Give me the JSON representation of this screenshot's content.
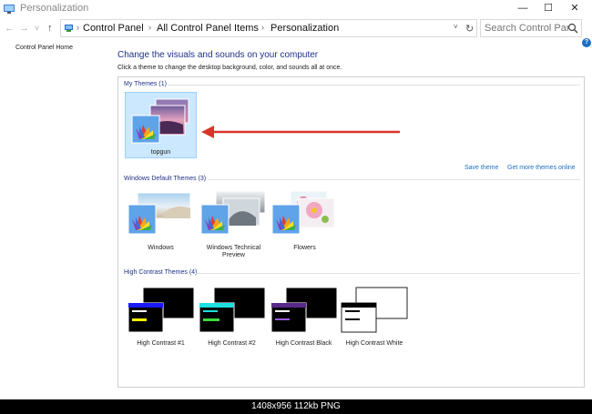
{
  "window": {
    "title": "Personalization",
    "controls": {
      "minimize": "—",
      "maximize": "☐",
      "close": "✕"
    }
  },
  "nav": {
    "back": "←",
    "forward": "→",
    "recent": "˅",
    "up": "↑",
    "breadcrumb": [
      "Control Panel",
      "All Control Panel Items",
      "Personalization"
    ],
    "breadcrumb_separator": "›",
    "dropdown": "˅",
    "refresh": "↻"
  },
  "search": {
    "placeholder": "Search Control Pan..."
  },
  "left_pane": {
    "home_link": "Control Panel Home"
  },
  "help": "?",
  "main": {
    "title": "Change the visuals and sounds on your computer",
    "subtitle": "Click a theme to change the desktop background, color, and sounds all at once.",
    "groups": {
      "my_themes": {
        "header": "My Themes (1)",
        "themes": [
          {
            "label": "topgun",
            "selected": true
          }
        ],
        "links": {
          "save": "Save theme",
          "more": "Get more themes online"
        }
      },
      "default_themes": {
        "header": "Windows Default Themes (3)",
        "themes": [
          {
            "label": "Windows"
          },
          {
            "label": "Windows Technical Preview"
          },
          {
            "label": "Flowers"
          }
        ]
      },
      "high_contrast": {
        "header": "High Contrast Themes (4)",
        "themes": [
          {
            "label": "High Contrast #1"
          },
          {
            "label": "High Contrast #2"
          },
          {
            "label": "High Contrast Black"
          },
          {
            "label": "High Contrast White"
          }
        ]
      }
    }
  },
  "colors": {
    "accent_blue": "#1e3287",
    "link_blue": "#1e6fbe",
    "selection_bg": "#cce8ff",
    "arrow_red": "#d9342b"
  },
  "footer": {
    "info": "1408x956  112kb  PNG"
  }
}
